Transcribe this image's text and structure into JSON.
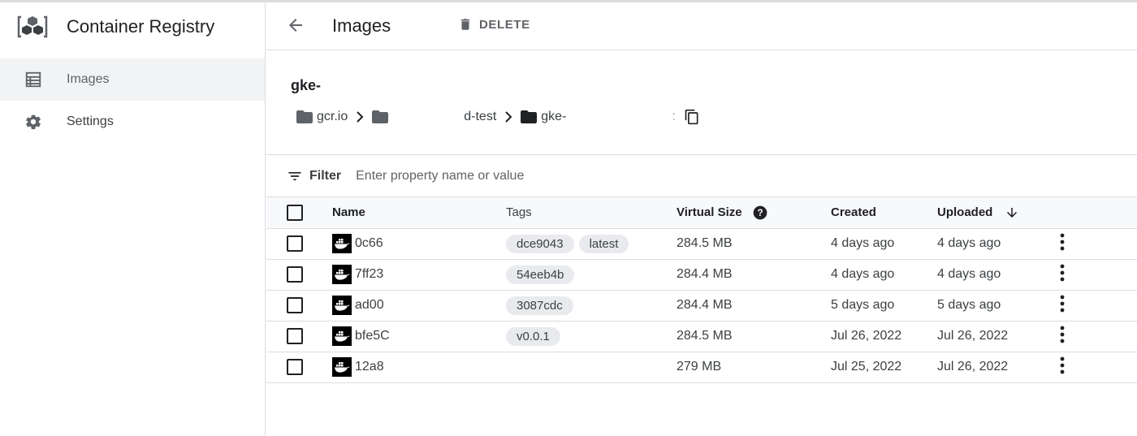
{
  "app": {
    "title": "Container Registry"
  },
  "sidebar": {
    "items": [
      {
        "label": "Images",
        "icon": "list-icon",
        "active": true
      },
      {
        "label": "Settings",
        "icon": "gear-icon",
        "active": false
      }
    ]
  },
  "toolbar": {
    "title": "Images",
    "delete_label": "DELETE"
  },
  "repo": {
    "name": "gke-",
    "breadcrumb": {
      "host": "gcr.io",
      "project_suffix": "d-test",
      "repo_prefix": "gke-",
      "repo_tail": ":"
    }
  },
  "filter": {
    "label": "Filter",
    "placeholder": "Enter property name or value"
  },
  "table": {
    "headers": {
      "name": "Name",
      "tags": "Tags",
      "size": "Virtual Size",
      "created": "Created",
      "uploaded": "Uploaded"
    },
    "rows": [
      {
        "name": "0c66",
        "tags": [
          "dce9043",
          "latest"
        ],
        "size": "284.5 MB",
        "created": "4 days ago",
        "uploaded": "4 days ago"
      },
      {
        "name": "7ff23",
        "tags": [
          "54eeb4b"
        ],
        "size": "284.4 MB",
        "created": "4 days ago",
        "uploaded": "4 days ago"
      },
      {
        "name": "ad00",
        "tags": [
          "3087cdc"
        ],
        "size": "284.4 MB",
        "created": "5 days ago",
        "uploaded": "5 days ago"
      },
      {
        "name": "bfe5C",
        "tags": [
          "v0.0.1"
        ],
        "size": "284.5 MB",
        "created": "Jul 26, 2022",
        "uploaded": "Jul 26, 2022"
      },
      {
        "name": "12a8",
        "tags": [],
        "size": "279 MB",
        "created": "Jul 25, 2022",
        "uploaded": "Jul 26, 2022"
      }
    ]
  },
  "colors": {
    "border": "#dadce0",
    "active_nav": "#f1f3f4",
    "chip": "#e8eaed",
    "text": "#202124"
  }
}
